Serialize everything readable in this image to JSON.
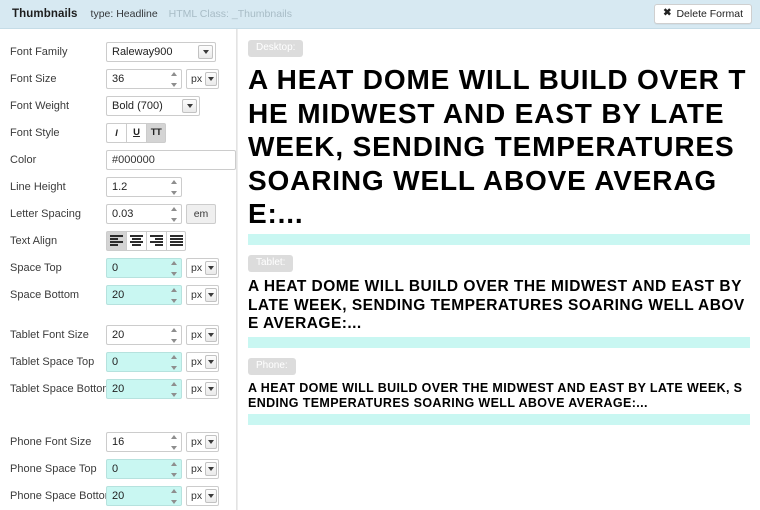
{
  "header": {
    "title": "Thumbnails",
    "type_label": "type: Headline",
    "html_class": "HTML Class: _Thumbnails",
    "delete_button": "Delete Format",
    "delete_icon": "times-icon",
    "bar_color": "#d7e9f2"
  },
  "settings": {
    "font_family": {
      "label": "Font Family",
      "value": "Raleway900"
    },
    "font_size": {
      "label": "Font Size",
      "value": "36",
      "unit": "px"
    },
    "font_weight": {
      "label": "Font Weight",
      "value": "Bold (700)"
    },
    "font_style": {
      "label": "Font Style",
      "buttons": [
        {
          "glyph": "I",
          "name": "italic-button",
          "active": false
        },
        {
          "glyph": "U",
          "name": "underline-button",
          "active": false
        },
        {
          "glyph": "TT",
          "name": "uppercase-button",
          "active": true
        }
      ]
    },
    "color": {
      "label": "Color",
      "value": "#000000"
    },
    "line_height": {
      "label": "Line Height",
      "value": "1.2"
    },
    "letter_spacing": {
      "label": "Letter Spacing",
      "value": "0.03",
      "unit": "em"
    },
    "text_align": {
      "label": "Text Align",
      "buttons": [
        {
          "name": "align-left-button",
          "active": true
        },
        {
          "name": "align-center-button",
          "active": false
        },
        {
          "name": "align-right-button",
          "active": false
        },
        {
          "name": "align-justify-button",
          "active": false
        }
      ]
    },
    "space_top": {
      "label": "Space Top",
      "value": "0",
      "unit": "px",
      "highlighted": true
    },
    "space_bottom": {
      "label": "Space Bottom",
      "value": "20",
      "unit": "px",
      "highlighted": true
    },
    "tablet_font_size": {
      "label": "Tablet Font Size",
      "value": "20",
      "unit": "px",
      "highlighted": false
    },
    "tablet_space_top": {
      "label": "Tablet Space Top",
      "value": "0",
      "unit": "px",
      "highlighted": true
    },
    "tablet_space_bottom": {
      "label": "Tablet Space Bottom",
      "value": "20",
      "unit": "px",
      "highlighted": true
    },
    "phone_font_size": {
      "label": "Phone Font Size",
      "value": "16",
      "unit": "px",
      "highlighted": false
    },
    "phone_space_top": {
      "label": "Phone Space Top",
      "value": "0",
      "unit": "px",
      "highlighted": true
    },
    "phone_space_bottom": {
      "label": "Phone Space Bottom",
      "value": "20",
      "unit": "px",
      "highlighted": true
    }
  },
  "preview": {
    "headline": "A HEAT DOME WILL BUILD OVER THE MIDWEST AND EAST BY LATE WEEK, SENDING TEMPERATURES SOARING WELL ABOVE AVERAGE:...",
    "desktop_badge": "Desktop:",
    "tablet_badge": "Tablet:",
    "phone_badge": "Phone:",
    "space_bar_color": "#c9f7f2"
  }
}
